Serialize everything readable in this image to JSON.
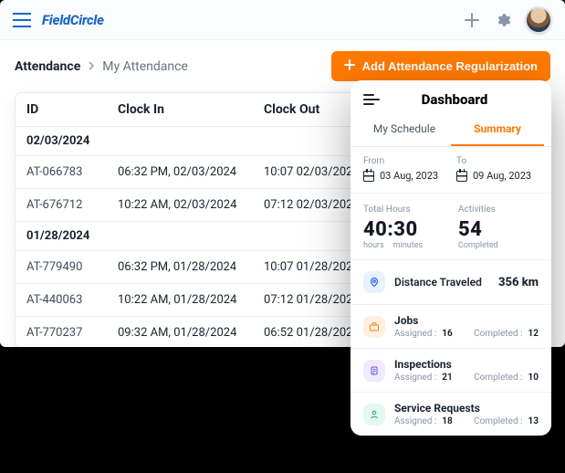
{
  "header": {
    "logo": "FieldCircle"
  },
  "breadcrumb": {
    "root": "Attendance",
    "leaf": "My Attendance"
  },
  "actions": {
    "add_label": "Add Attendance Regularization"
  },
  "table": {
    "columns": {
      "id": "ID",
      "clock_in": "Clock In",
      "clock_out": "Clock Out"
    },
    "groups": [
      {
        "date": "02/03/2024",
        "rows": [
          {
            "id": "AT-066783",
            "clock_in": "06:32 PM, 02/03/2024",
            "clock_out": "10:07 02/03/2024"
          },
          {
            "id": "AT-676712",
            "clock_in": "10:22 AM, 02/03/2024",
            "clock_out": "07:12 02/03/2024"
          }
        ]
      },
      {
        "date": "01/28/2024",
        "rows": [
          {
            "id": "AT-779490",
            "clock_in": "06:32 PM, 01/28/2024",
            "clock_out": "10:07 01/28/2024"
          },
          {
            "id": "AT-440063",
            "clock_in": "10:22 AM, 01/28/2024",
            "clock_out": "07:12 01/28/2024"
          },
          {
            "id": "AT-770237",
            "clock_in": "09:32 AM, 01/28/2024",
            "clock_out": "06:52 01/28/2024"
          }
        ]
      }
    ]
  },
  "panel": {
    "title": "Dashboard",
    "tabs": {
      "schedule": "My Schedule",
      "summary": "Summary",
      "active": "summary"
    },
    "date_range": {
      "from_label": "From",
      "from_value": "03 Aug, 2023",
      "to_label": "To",
      "to_value": "09 Aug, 2023"
    },
    "stats": {
      "total_hours_label": "Total Hours",
      "total_hours_value": "40:30",
      "total_hours_sub1": "hours",
      "total_hours_sub2": "minutes",
      "activities_label": "Activities",
      "activities_value": "54",
      "activities_sub": "Completed"
    },
    "distance": {
      "label": "Distance Traveled",
      "value": "356 km"
    },
    "categories": [
      {
        "icon": "briefcase-icon",
        "title": "Jobs",
        "assigned_label": "Assigned :",
        "assigned": "16",
        "completed_label": "Completed :",
        "completed": "12"
      },
      {
        "icon": "clipboard-icon",
        "title": "Inspections",
        "assigned_label": "Assigned :",
        "assigned": "21",
        "completed_label": "Completed :",
        "completed": "10"
      },
      {
        "icon": "service-icon",
        "title": "Service Requests",
        "assigned_label": "Assigned :",
        "assigned": "18",
        "completed_label": "Completed :",
        "completed": "13"
      }
    ]
  }
}
